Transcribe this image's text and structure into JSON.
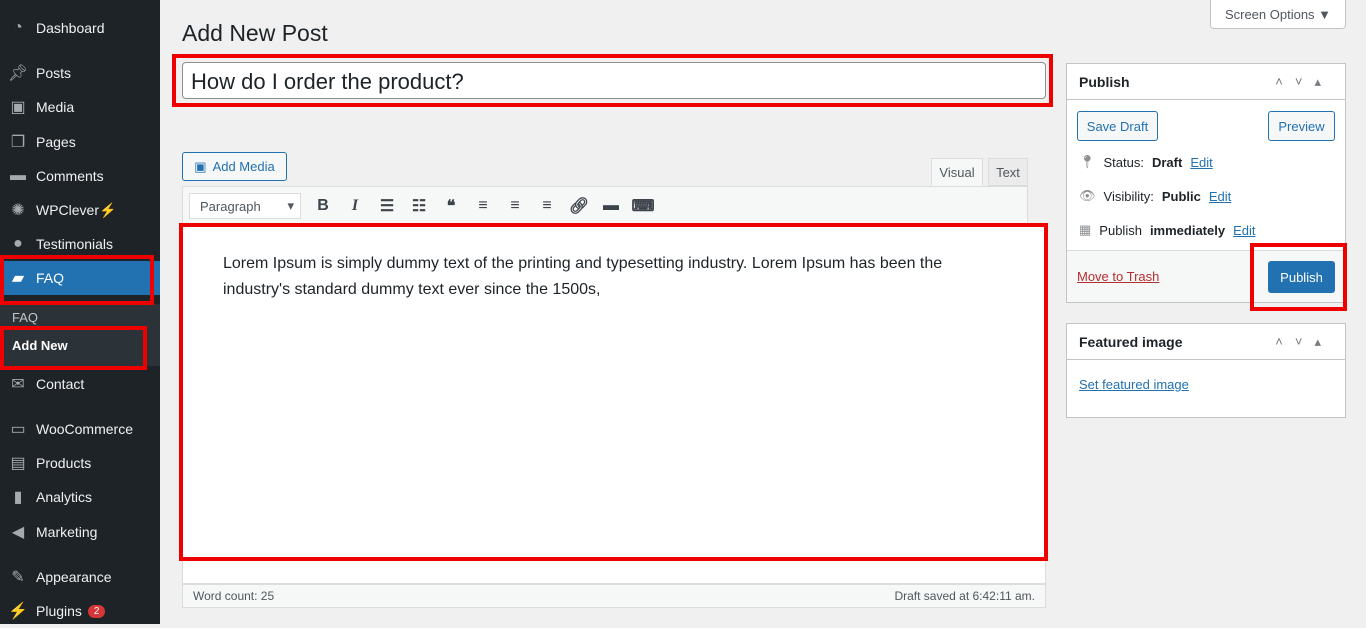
{
  "sidebar": {
    "items": [
      {
        "label": "Dashboard",
        "icon": "dashboard-icon"
      },
      {
        "label": "Posts",
        "icon": "pin-icon"
      },
      {
        "label": "Media",
        "icon": "media-icon"
      },
      {
        "label": "Pages",
        "icon": "pages-icon"
      },
      {
        "label": "Comments",
        "icon": "comment-icon"
      },
      {
        "label": "WPClever",
        "icon": "bulb-icon"
      },
      {
        "label": "Testimonials",
        "icon": "user-icon"
      },
      {
        "label": "FAQ",
        "icon": "folder-icon"
      },
      {
        "label": "Contact",
        "icon": "mail-icon"
      },
      {
        "label": "WooCommerce",
        "icon": "woo-icon"
      },
      {
        "label": "Products",
        "icon": "archive-icon"
      },
      {
        "label": "Analytics",
        "icon": "chart-icon"
      },
      {
        "label": "Marketing",
        "icon": "megaphone-icon"
      },
      {
        "label": "Appearance",
        "icon": "brush-icon"
      },
      {
        "label": "Plugins",
        "icon": "plug-icon"
      }
    ],
    "wpclever_suffix": "⚡",
    "submenu": {
      "header": "FAQ",
      "add_new": "Add New"
    },
    "plugins_badge": "2"
  },
  "header": {
    "title": "Add New Post",
    "screen_options": "Screen Options ▼"
  },
  "post": {
    "title": "How do I order the product?",
    "content": "Lorem Ipsum is simply dummy text of the printing and typesetting industry. Lorem Ipsum has been the industry's standard dummy text ever since the 1500s,"
  },
  "editor": {
    "add_media": "Add Media",
    "tab_visual": "Visual",
    "tab_text": "Text",
    "format": "Paragraph",
    "word_count": "Word count: 25",
    "draft_saved": "Draft saved at 6:42:11 am."
  },
  "publish": {
    "title": "Publish",
    "save_draft": "Save Draft",
    "preview": "Preview",
    "status_label": "Status:",
    "status": "Draft",
    "visibility_label": "Visibility:",
    "visibility": "Public",
    "publish_label": "Publish",
    "publish_when": "immediately",
    "edit": "Edit",
    "trash": "Move to Trash",
    "publish_button": "Publish"
  },
  "featured": {
    "title": "Featured image",
    "set": "Set featured image"
  },
  "colors": {
    "accent": "#2271b1",
    "highlight": "#ee0000",
    "sidebar": "#1d2327"
  }
}
